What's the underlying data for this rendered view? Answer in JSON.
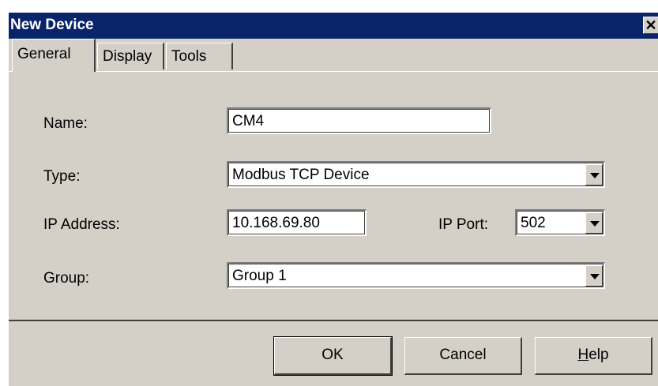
{
  "window": {
    "title": "New Device",
    "close_label": "✕"
  },
  "tabs": [
    {
      "label": "General",
      "active": true
    },
    {
      "label": "Display",
      "active": false
    },
    {
      "label": "Tools",
      "active": false
    }
  ],
  "form": {
    "name_label": "Name:",
    "name_value": "CM4",
    "type_label": "Type:",
    "type_value": "Modbus TCP Device",
    "ip_address_label": "IP Address:",
    "ip_address_value": "10.168.69.80",
    "ip_port_label": "IP Port:",
    "ip_port_value": "502",
    "group_label": "Group:",
    "group_value": "Group 1"
  },
  "buttons": {
    "ok": "OK",
    "cancel": "Cancel",
    "help_prefix": "H",
    "help_rest": "elp"
  },
  "colors": {
    "titlebar": "#0a246a",
    "face": "#d4d0c8"
  }
}
